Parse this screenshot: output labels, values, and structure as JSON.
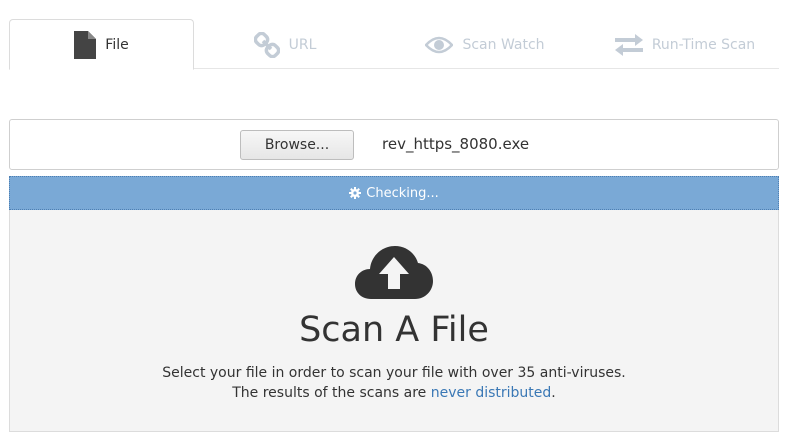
{
  "tabs": [
    {
      "label": "File",
      "icon": "file-icon",
      "active": true
    },
    {
      "label": "URL",
      "icon": "link-icon",
      "active": false
    },
    {
      "label": "Scan Watch",
      "icon": "eye-icon",
      "active": false
    },
    {
      "label": "Run-Time Scan",
      "icon": "exchange-icon",
      "active": false
    }
  ],
  "upload": {
    "browse_label": "Browse...",
    "file_name": "rev_https_8080.exe"
  },
  "progress": {
    "label": "Checking...",
    "icon": "gear-icon"
  },
  "drop": {
    "icon": "cloud-upload-icon",
    "title": "Scan A File",
    "line1": "Select your file in order to scan your file with over 35 anti-viruses.",
    "line2_prefix": "The results of the scans are ",
    "line2_link": "never distributed",
    "line2_suffix": "."
  },
  "colors": {
    "progress_bg": "#7aa9d6",
    "inactive_tab": "#c3ccd6",
    "link": "#3a78b5"
  }
}
